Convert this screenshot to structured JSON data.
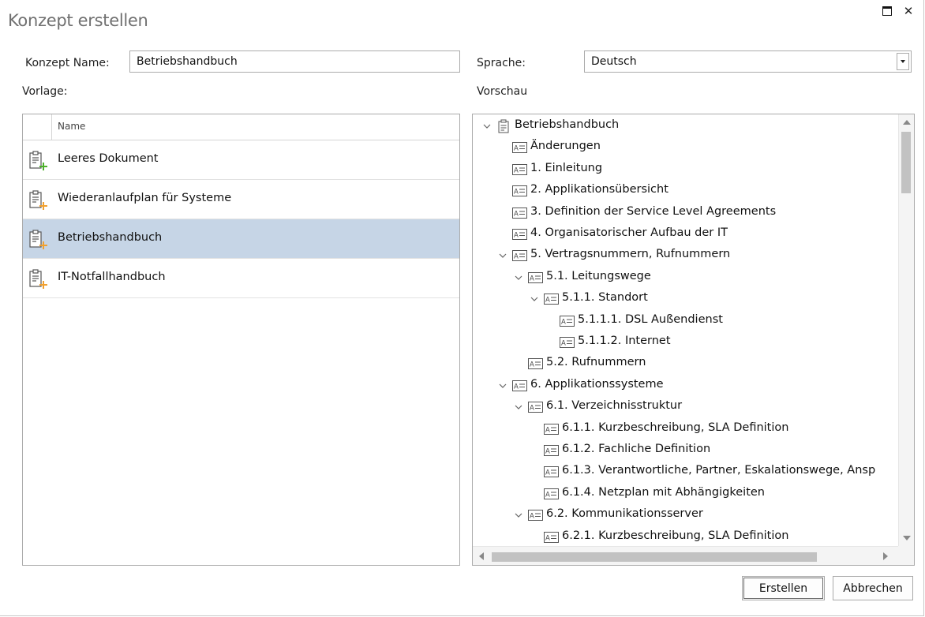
{
  "dialog": {
    "title": "Konzept erstellen"
  },
  "form": {
    "name_label": "Konzept Name:",
    "name_value": "Betriebshandbuch",
    "language_label": "Sprache:",
    "language_value": "Deutsch",
    "template_label": "Vorlage:",
    "preview_label": "Vorschau"
  },
  "templates": {
    "column_header": "Name",
    "items": [
      {
        "label": "Leeres Dokument",
        "icon": "clipboard-plus-green-icon",
        "selected": false
      },
      {
        "label": "Wiederanlaufplan für Systeme",
        "icon": "clipboard-plus-orange-icon",
        "selected": false
      },
      {
        "label": "Betriebshandbuch",
        "icon": "clipboard-plus-orange-icon",
        "selected": true
      },
      {
        "label": "IT-Notfallhandbuch",
        "icon": "clipboard-plus-orange-icon",
        "selected": false
      }
    ]
  },
  "tree": {
    "nodes": [
      {
        "label": "Betriebshandbuch",
        "level": 0,
        "expanded": true,
        "icon": "clipboard-icon"
      },
      {
        "label": "Änderungen",
        "level": 1,
        "icon": "section-icon"
      },
      {
        "label": "1. Einleitung",
        "level": 1,
        "icon": "section-icon"
      },
      {
        "label": "2. Applikationsübersicht",
        "level": 1,
        "icon": "section-icon"
      },
      {
        "label": "3. Definition der Service Level Agreements",
        "level": 1,
        "icon": "section-icon"
      },
      {
        "label": "4. Organisatorischer Aufbau der IT",
        "level": 1,
        "icon": "section-icon"
      },
      {
        "label": "5. Vertragsnummern, Rufnummern",
        "level": 1,
        "expanded": true,
        "icon": "section-icon"
      },
      {
        "label": "5.1. Leitungswege",
        "level": 2,
        "expanded": true,
        "icon": "section-icon"
      },
      {
        "label": "5.1.1. Standort",
        "level": 3,
        "expanded": true,
        "icon": "section-icon"
      },
      {
        "label": "5.1.1.1. DSL Außendienst",
        "level": 4,
        "icon": "section-icon"
      },
      {
        "label": "5.1.1.2. Internet",
        "level": 4,
        "icon": "section-icon"
      },
      {
        "label": "5.2. Rufnummern",
        "level": 2,
        "icon": "section-icon"
      },
      {
        "label": "6. Applikationssysteme",
        "level": 1,
        "expanded": true,
        "icon": "section-icon"
      },
      {
        "label": "6.1. Verzeichnisstruktur",
        "level": 2,
        "expanded": true,
        "icon": "section-icon"
      },
      {
        "label": "6.1.1. Kurzbeschreibung, SLA Definition",
        "level": 3,
        "icon": "section-icon"
      },
      {
        "label": "6.1.2. Fachliche Definition",
        "level": 3,
        "icon": "section-icon"
      },
      {
        "label": "6.1.3. Verantwortliche, Partner, Eskalationswege, Ansp",
        "level": 3,
        "icon": "section-icon"
      },
      {
        "label": "6.1.4. Netzplan mit Abhängigkeiten",
        "level": 3,
        "icon": "section-icon"
      },
      {
        "label": "6.2. Kommunikationsserver",
        "level": 2,
        "expanded": true,
        "icon": "section-icon"
      },
      {
        "label": "6.2.1. Kurzbeschreibung, SLA Definition",
        "level": 3,
        "icon": "section-icon"
      }
    ]
  },
  "buttons": {
    "create": "Erstellen",
    "cancel": "Abbrechen"
  },
  "colors": {
    "selection": "#c6d5e6",
    "green_plus": "#4caf2a",
    "orange_plus": "#f0a030"
  }
}
